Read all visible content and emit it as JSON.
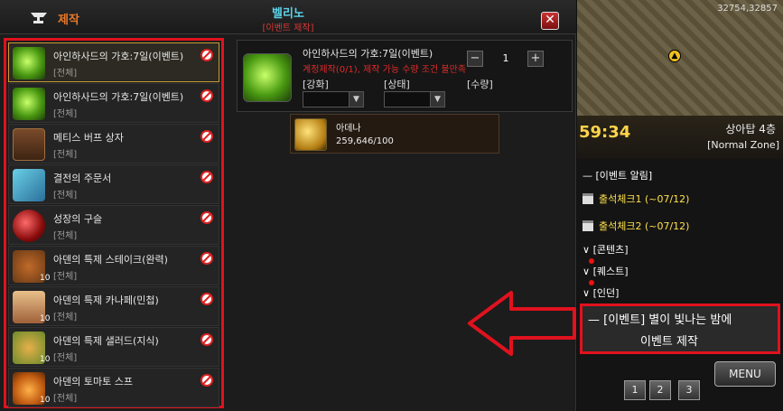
{
  "window": {
    "title": "제작",
    "npc_name": "벨리노",
    "npc_subtitle": "[이벤트 제작]",
    "close_label": "✕"
  },
  "items": [
    {
      "name": "아인하사드의 가호:7일(이벤트)",
      "category": "[전체]",
      "icon": "green-gem-icon",
      "count": ""
    },
    {
      "name": "아인하사드의 가호:7일(이벤트)",
      "category": "[전체]",
      "icon": "green-gem-icon",
      "count": ""
    },
    {
      "name": "메티스 버프 상자",
      "category": "[전체]",
      "icon": "chest-icon",
      "count": ""
    },
    {
      "name": "결전의 주문서",
      "category": "[전체]",
      "icon": "scroll-icon",
      "count": ""
    },
    {
      "name": "성장의 구슬",
      "category": "[전체]",
      "icon": "orb-icon",
      "count": ""
    },
    {
      "name": "아덴의 특제 스테이크(완력)",
      "category": "[전체]",
      "icon": "steak-icon",
      "count": "10"
    },
    {
      "name": "아덴의 특제 카나페(민첩)",
      "category": "[전체]",
      "icon": "canape-icon",
      "count": "10"
    },
    {
      "name": "아덴의 특제 샐러드(지식)",
      "category": "[전체]",
      "icon": "salad-icon",
      "count": "10"
    },
    {
      "name": "아덴의 토마토 스프",
      "category": "[전체]",
      "icon": "soup-icon",
      "count": "10"
    }
  ],
  "detail": {
    "name": "아인하사드의 가호:7일(이벤트)",
    "warning": "계정제작(0/1), 제작 가능 수량 조건 불만족",
    "enhance_label": "[강화]",
    "state_label": "[상태]",
    "qty_label": "[수량]",
    "qty_value": "1",
    "minus": "−",
    "plus": "+"
  },
  "material": {
    "name": "아데나",
    "amount": "259,646/100"
  },
  "hud": {
    "coords": "32754,32857",
    "timer": "59:34",
    "zone": "상아탑 4층",
    "zone_mode": "[Normal Zone]",
    "event_header": "[이벤트 알림]",
    "event_items": [
      "출석체크1 (~07/12)",
      "출석체크2 (~07/12)"
    ],
    "sections": [
      "[콘텐츠]",
      "[퀘스트]",
      "[인던]"
    ],
    "banner_title": "[이벤트] 별이 빛나는 밤에",
    "banner_sub": "이벤트 제작",
    "menu": "MENU",
    "pages": [
      "1",
      "2",
      "3"
    ]
  },
  "colors": {
    "highlight_red": "#e0121e",
    "title_orange": "#e8782a",
    "npc_cyan": "#5bd3e8",
    "event_yellow": "#ffe14a",
    "timer_yellow": "#ffd54a"
  }
}
